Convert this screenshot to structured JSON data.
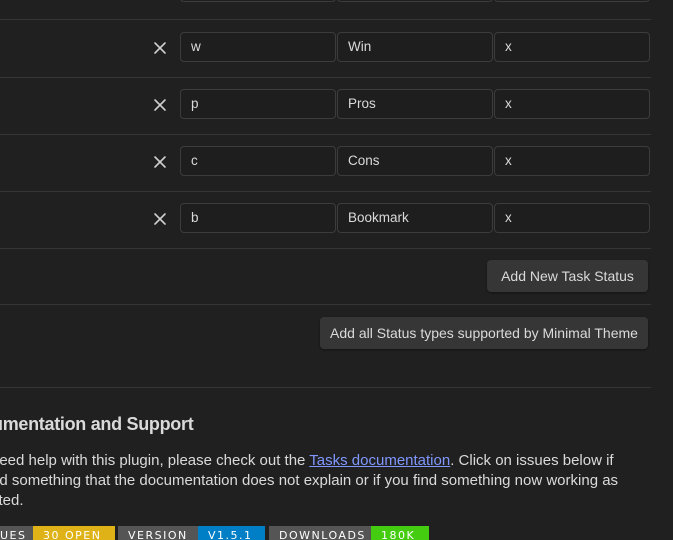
{
  "task_statuses": [
    {
      "symbol": "",
      "name": "",
      "next": ""
    },
    {
      "symbol": "w",
      "name": "Win",
      "next": "x"
    },
    {
      "symbol": "p",
      "name": "Pros",
      "next": "x"
    },
    {
      "symbol": "c",
      "name": "Cons",
      "next": "x"
    },
    {
      "symbol": "b",
      "name": "Bookmark",
      "next": "x"
    }
  ],
  "buttons": {
    "add_new": "Add New Task Status",
    "add_minimal": "Add all Status types supported by Minimal Theme"
  },
  "support": {
    "heading": "umentation and Support",
    "line1_before": " need help with this plugin, please check out the ",
    "link": "Tasks documentation",
    "line1_after": ". Click on issues below if",
    "line2": "nd something that the documentation does not explain or if you find something now working as",
    "line3": "cted."
  },
  "badges": [
    {
      "key": "UES",
      "value": "30 OPEN",
      "color": "#dfb317"
    },
    {
      "key": "VERSION",
      "value": "V1.5.1",
      "color": "#007ec6"
    },
    {
      "key": "DOWNLOADS",
      "value": "180K",
      "color": "#44cc11"
    }
  ],
  "icons": {
    "delete": "close-x-icon"
  }
}
